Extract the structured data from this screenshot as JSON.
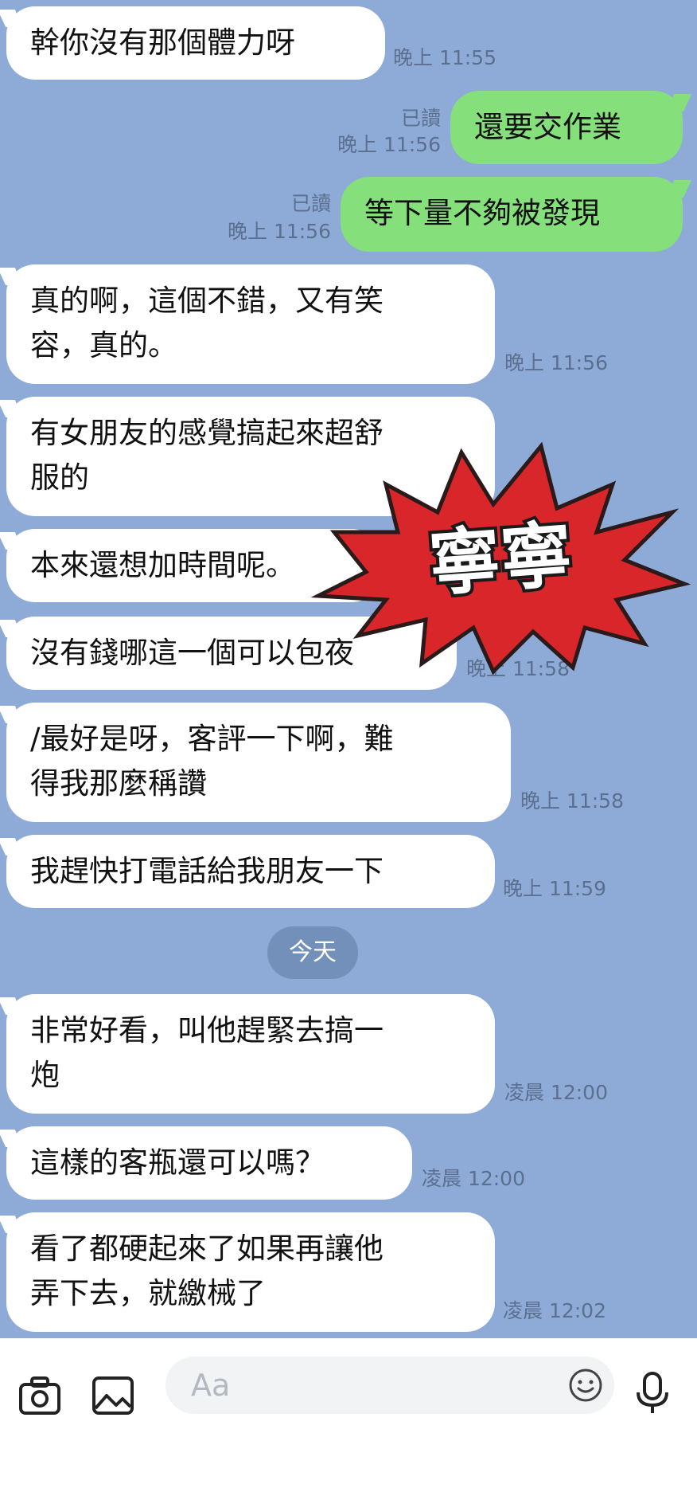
{
  "messages": [
    {
      "text": "幹你沒有那個體力呀",
      "time": "晚上 11:55"
    },
    {
      "text": "還要交作業",
      "read": "已讀",
      "time": "晚上 11:56"
    },
    {
      "text": "等下量不夠被發現",
      "read": "已讀",
      "time": "晚上 11:56"
    },
    {
      "text": "真的啊，這個不錯，又有笑\n容，真的。",
      "time": "晚上 11:56"
    },
    {
      "text": "有女朋友的感覺搞起來超舒\n服的",
      "time": ""
    },
    {
      "text": "本來還想加時間呢。",
      "time": ""
    },
    {
      "text": "沒有錢哪這一個可以包夜",
      "time": "晚上 11:58"
    },
    {
      "text": "/最好是呀，客評一下啊，難\n得我那麼稱讚",
      "time": "晚上 11:58"
    },
    {
      "text": "我趕快打電話給我朋友一下",
      "time": "晚上 11:59"
    },
    {
      "text": "非常好看，叫他趕緊去搞一\n炮",
      "time": "凌晨 12:00"
    },
    {
      "text": "這樣的客瓶還可以嗎？",
      "time": "凌晨 12:00"
    },
    {
      "text": "看了都硬起來了如果再讓他\n弄下去，就繳械了",
      "time": "凌晨 12:02"
    }
  ],
  "day_separator": "今天",
  "sticker_text": "寧寧",
  "input": {
    "placeholder": "Aa"
  },
  "icons": {
    "camera": "camera-icon",
    "gallery": "image-icon",
    "emoji": "smiley-icon",
    "mic": "microphone-icon"
  },
  "colors": {
    "background": "#8eabd8",
    "incoming": "#ffffff",
    "outgoing": "#85e07c",
    "sticker_fill": "#d8262b"
  }
}
